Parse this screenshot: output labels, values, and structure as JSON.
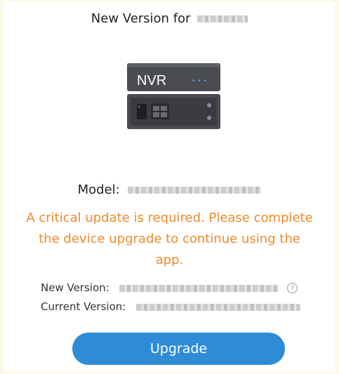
{
  "header": {
    "title_prefix": "New Version for"
  },
  "device_image": {
    "label": "NVR",
    "dots": "• • •",
    "accent_color": "#4aa3ff"
  },
  "model": {
    "label": "Model:"
  },
  "warning": {
    "text": "A critical update is required. Please complete the device upgrade to continue using the app.",
    "color": "#ef8a2a"
  },
  "versions": {
    "new_label": "New Version:",
    "current_label": "Current Version:",
    "help_icon": "?"
  },
  "actions": {
    "upgrade_label": "Upgrade",
    "button_color": "#2e8cd6"
  }
}
